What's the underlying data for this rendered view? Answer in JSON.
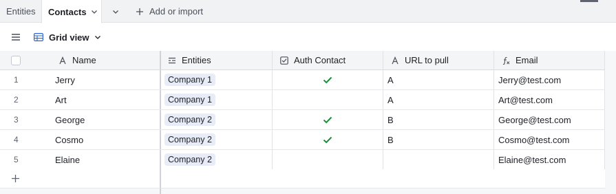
{
  "tabs": {
    "entities_label": "Entities",
    "contacts_label": "Contacts",
    "add_import_label": "Add or import"
  },
  "view": {
    "name": "Grid view"
  },
  "columns": {
    "name": "Name",
    "entities": "Entities",
    "auth": "Auth Contact",
    "url": "URL to pull",
    "email": "Email"
  },
  "rows": [
    {
      "num": "1",
      "name": "Jerry",
      "entity": "Company 1",
      "auth": true,
      "url": "A",
      "email": "Jerry@test.com"
    },
    {
      "num": "2",
      "name": "Art",
      "entity": "Company 1",
      "auth": false,
      "url": "A",
      "email": "Art@test.com"
    },
    {
      "num": "3",
      "name": "George",
      "entity": "Company 2",
      "auth": true,
      "url": "B",
      "email": "George@test.com"
    },
    {
      "num": "4",
      "name": "Cosmo",
      "entity": "Company 2",
      "auth": true,
      "url": "B",
      "email": "Cosmo@test.com"
    },
    {
      "num": "5",
      "name": "Elaine",
      "entity": "Company 2",
      "auth": false,
      "url": "",
      "email": "Elaine@test.com"
    }
  ],
  "colors": {
    "accent_check": "#1a8f3a",
    "pill_bg": "#e8ecf6",
    "grid_icon": "#2f66d0"
  },
  "icons": {
    "tab_chevron": "chevron-down-icon",
    "more_tabs": "chevron-down-icon",
    "add": "plus-icon",
    "menu": "hamburger-icon",
    "view": "grid-view-icon",
    "name_col": "text-field-icon",
    "entities_col": "linked-record-icon",
    "auth_col": "checkbox-field-icon",
    "url_col": "text-field-icon",
    "email_col": "formula-icon",
    "check": "checkmark-icon",
    "add_row": "plus-icon"
  }
}
